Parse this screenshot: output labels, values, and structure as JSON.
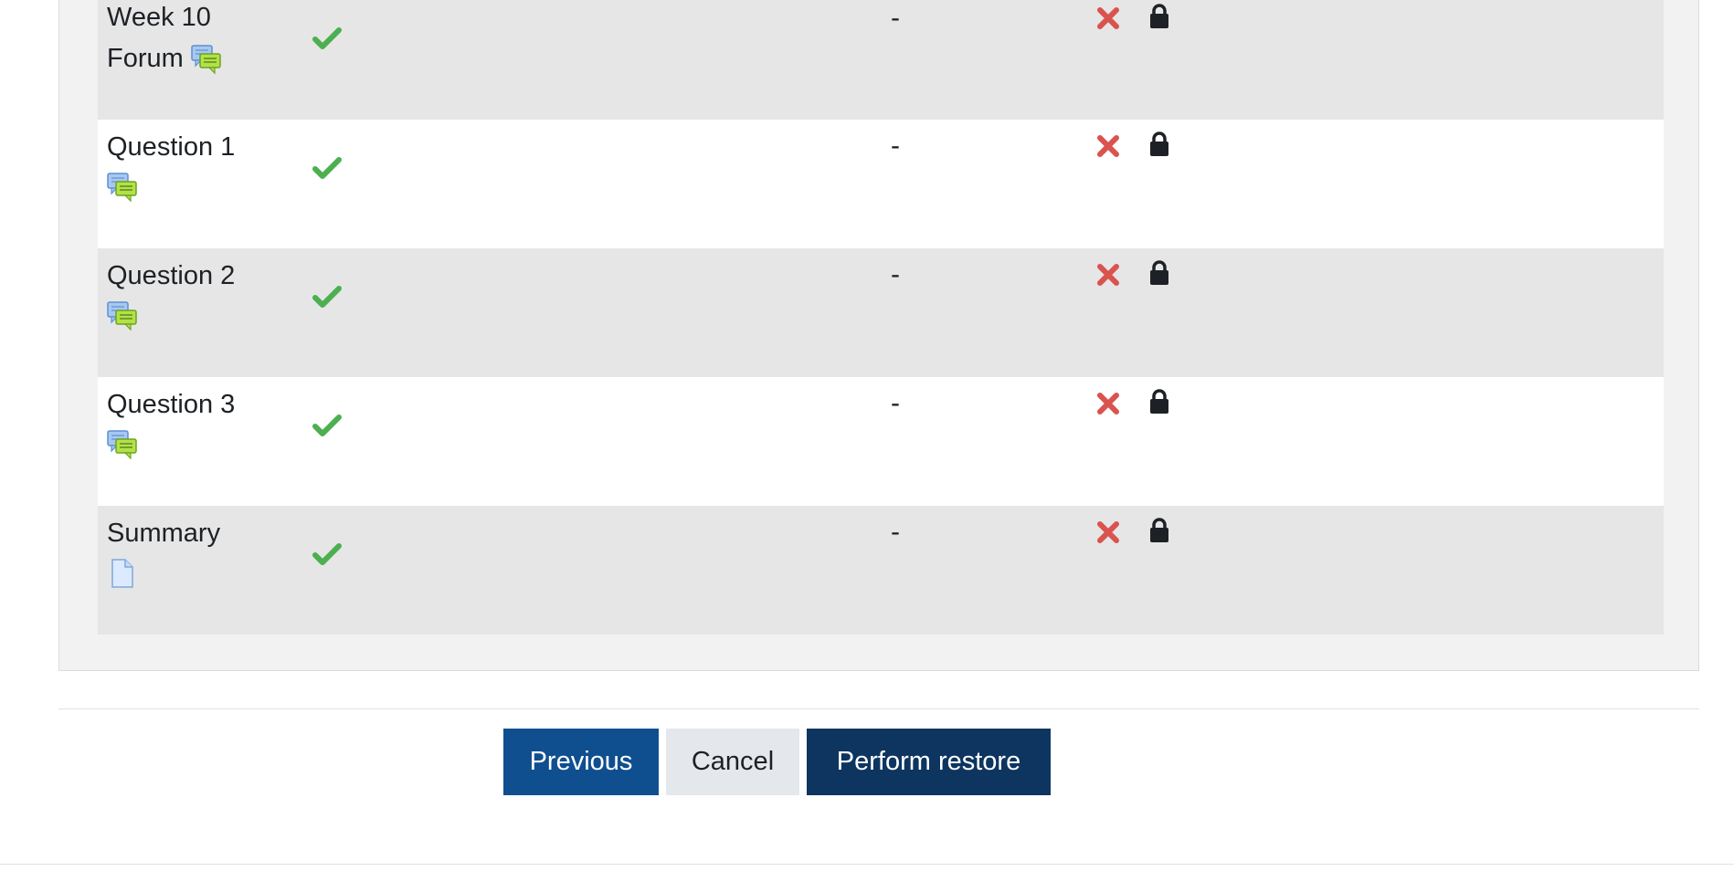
{
  "colors": {
    "check": "#4caf50",
    "cross": "#d9534f",
    "lock": "#1d2125",
    "primary_button": "#0f4f8f",
    "restore_button": "#0d3560",
    "secondary_button": "#e4e8ec"
  },
  "rows": [
    {
      "name": "Week 10 Forum",
      "icon": "forum-icon",
      "included": "check-icon",
      "value": "-",
      "user_data": "cross-icon",
      "locked": "lock-icon"
    },
    {
      "name": "Question 1",
      "icon": "forum-icon",
      "included": "check-icon",
      "value": "-",
      "user_data": "cross-icon",
      "locked": "lock-icon"
    },
    {
      "name": "Question 2",
      "icon": "forum-icon",
      "included": "check-icon",
      "value": "-",
      "user_data": "cross-icon",
      "locked": "lock-icon"
    },
    {
      "name": "Question 3",
      "icon": "forum-icon",
      "included": "check-icon",
      "value": "-",
      "user_data": "cross-icon",
      "locked": "lock-icon"
    },
    {
      "name": "Summary",
      "icon": "page-icon",
      "included": "check-icon",
      "value": "-",
      "user_data": "cross-icon",
      "locked": "lock-icon"
    }
  ],
  "buttons": {
    "previous": "Previous",
    "cancel": "Cancel",
    "perform_restore": "Perform restore"
  }
}
